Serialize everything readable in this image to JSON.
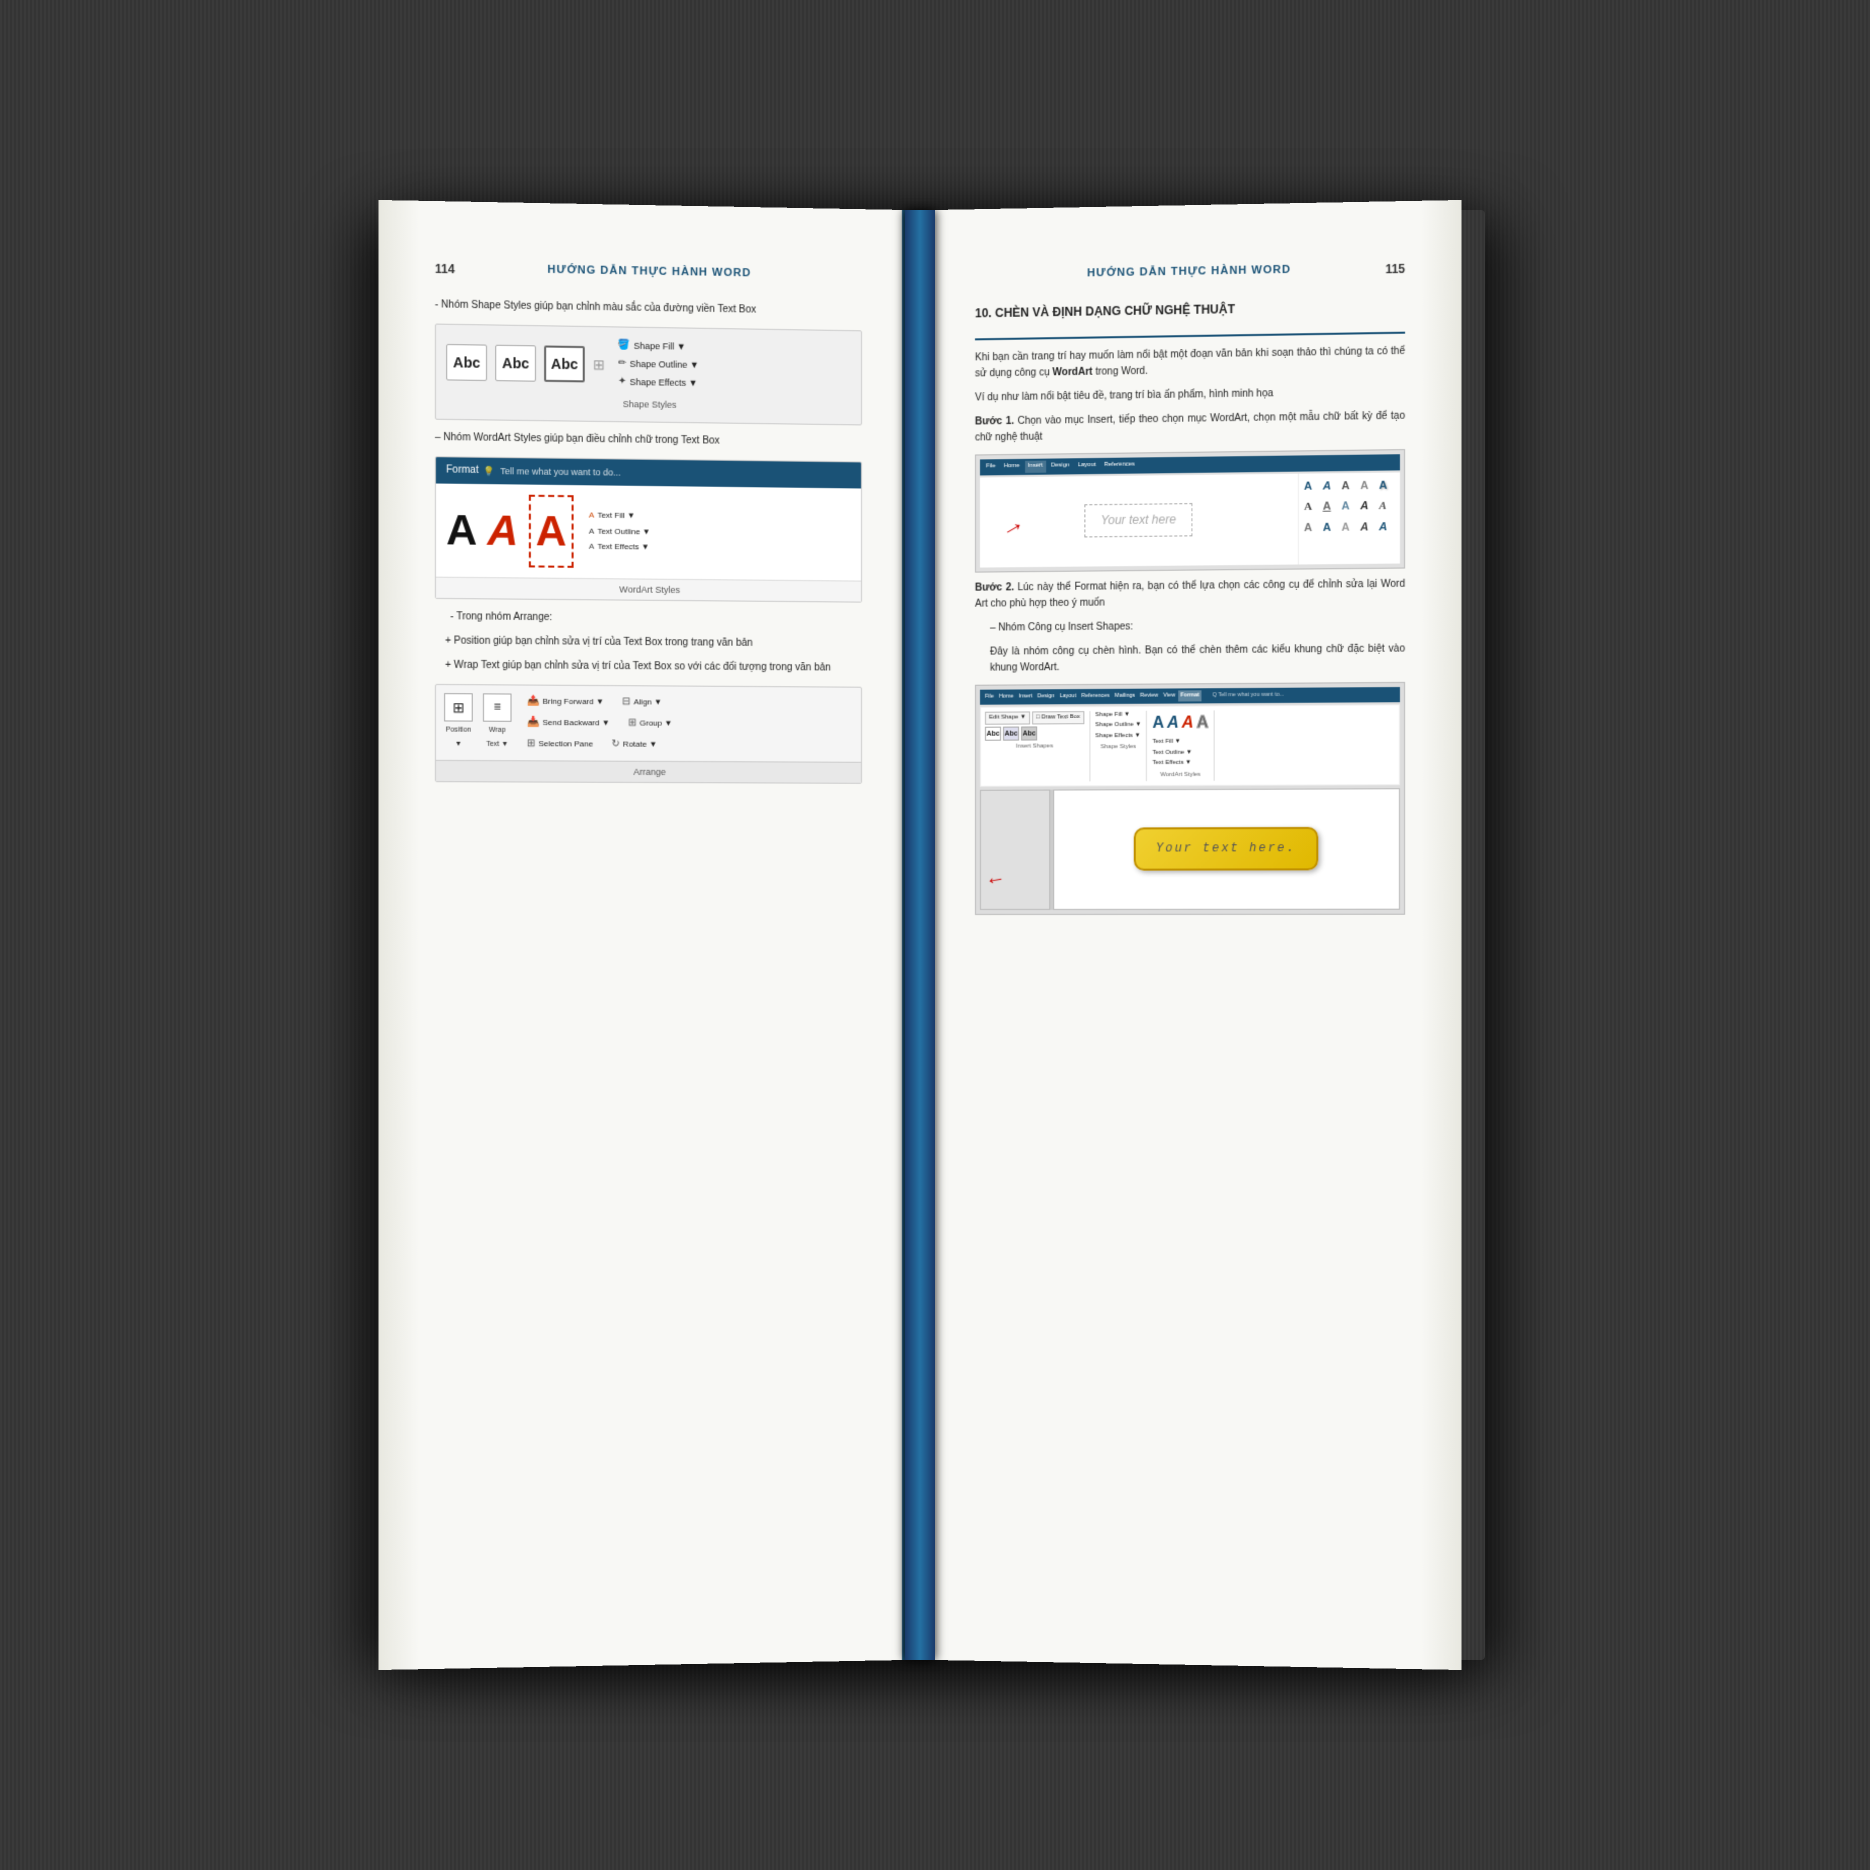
{
  "book": {
    "background_color": "#3a3a3a",
    "spine_color": "#1a3a6b"
  },
  "page_left": {
    "page_number": "114",
    "header": "HƯỚNG DẪN THỰC HÀNH WORD",
    "content": {
      "intro": "- Nhóm Shape Styles giúp bạn chỉnh màu sắc của đường viền Text Box",
      "shape_fill_label": "Shape Fill ▼",
      "shape_outline_label": "Shape Outline ▼",
      "shape_effects_label": "Shape Effects ▼",
      "shape_styles_footer": "Shape Styles",
      "abc_labels": [
        "Abc",
        "Abc",
        "Abc"
      ],
      "wordart_intro": "– Nhóm WordArt Styles giúp bạn điều chỉnh chữ trong Text Bo",
      "format_tab": "Format",
      "tell_me": "Tell me what you want to do...",
      "text_fill_label": "Text Fill ▼",
      "text_outline_label": "Text Outline ▼",
      "text_effects_label": "Text Effects ▼",
      "wordart_styles_footer": "WordArt Styles",
      "arrange_intro": "- Trong nhóm Arrange:",
      "position_desc": "+ Position giúp bạn chỉnh sửa vị trí của Text Box trong trang văn b",
      "wrap_desc": "+ Wrap Text giúp bạn chỉnh sửa vị trí của Text Box so với các đối tượng trong văn bản",
      "bring_forward": "Bring Forward ▼",
      "send_backward": "Send Backward ▼",
      "selection_pane": "Selection Pane",
      "align": "Align ▼",
      "group": "Group ▼",
      "rotate": "Rotate ▼",
      "position_label": "Position",
      "wrap_text_label": "Wrap\nText ▼",
      "arrange_footer": "Arrange"
    }
  },
  "page_right": {
    "page_number": "115",
    "header": "HƯỚNG DẪN THỰC HÀNH WORD",
    "section_number": "10.",
    "section_title": "CHÈN VÀ ĐỊNH DẠNG CHỮ NGHỆ THUẬT",
    "content": {
      "intro": "Khi bạn cần trang trí hay muốn làm nổi bật một đoạn văn bản khi soạn thảo thì chúng ta có thể sử dụng công cụ WordArt trong Word.",
      "wordart_bold": "WordArt",
      "example": "Ví dụ như làm nổi bật tiêu đề, trang trí bìa ấn phẩm, hình minh họa",
      "step1_label": "Bước 1.",
      "step1_text": "Chọn vào mục Insert, tiếp theo chọn mục WordArt, chọn một mẫu chữ bất kỳ để tạo chữ nghệ thuật",
      "your_text_here": "Your text here",
      "step2_label": "Bước 2.",
      "step2_text": "Lúc này thể Format hiện ra, bạn có thể lựa chọn các công cụ để chỉnh sửa lại Word Art cho phù hợp theo ý muốn",
      "insert_shapes_label": "– Nhóm Công cụ Insert Shapes:",
      "insert_shapes_desc": "Đây là nhóm công cụ chèn hình. Bạn có thể chèn thêm các kiểu khung chữ đặc biệt vào khung WordArt.",
      "ribbon_tabs": [
        "File",
        "Home",
        "Insert",
        "Design",
        "Layout",
        "References",
        "Mailings",
        "Review",
        "View",
        "Format"
      ],
      "shape_fill2": "Shape Fill ▼",
      "shape_outline2": "Shape Outline ▼",
      "shape_effects2": "Shape Effects ▼",
      "text_fill2": "Text Fill ▼",
      "text_outline2": "Text Outline ▼",
      "text_effects2": "Text Effects ▼",
      "your_text_here2": "Your text here."
    }
  }
}
